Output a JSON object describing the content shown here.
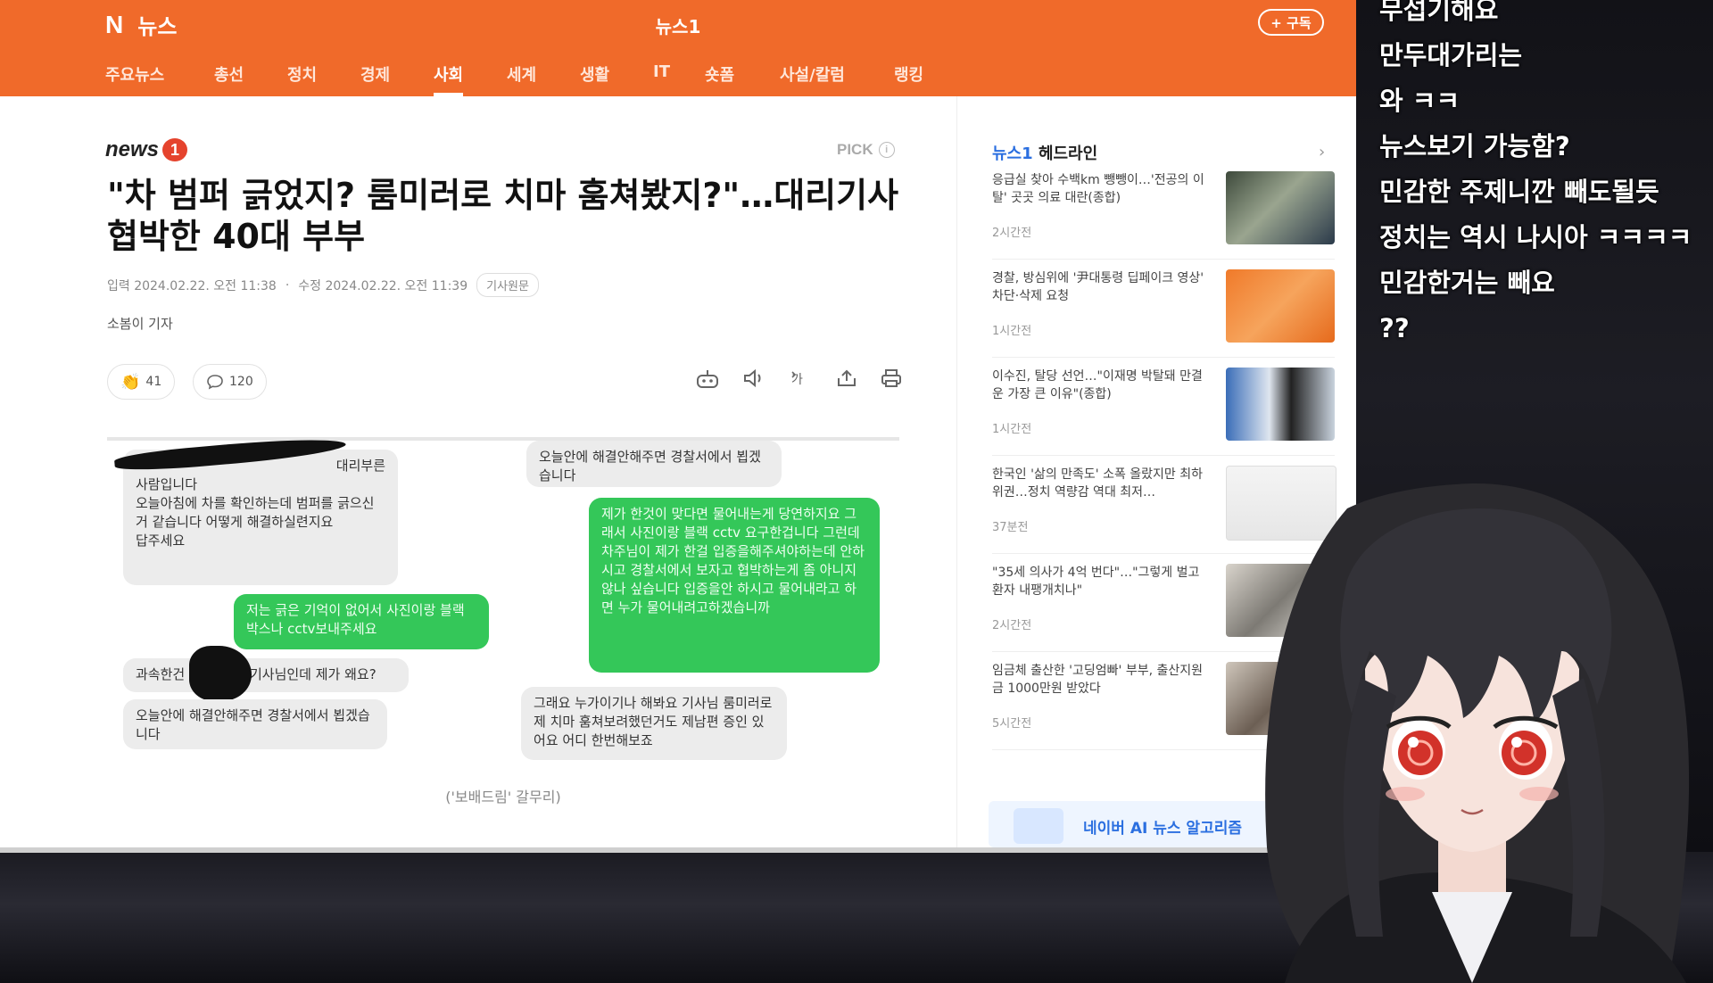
{
  "header": {
    "brand_mark": "N",
    "brand_word": "뉴스",
    "site_title": "뉴스1",
    "subscribe_label": "+ 구독",
    "accent_color": "#f06a2a"
  },
  "nav": {
    "items": [
      "주요뉴스",
      "총선",
      "정치",
      "경제",
      "사회",
      "세계",
      "생활",
      "IT",
      "숏폼",
      "사설/칼럼",
      "랭킹"
    ],
    "active": "사회"
  },
  "article": {
    "logo_text": "news",
    "logo_num": "1",
    "pick_label": "PICK",
    "pick_info": "i",
    "headline_line1": "\"차 범퍼 긁었지? 룸미러로 치마 훔쳐봤지?\"…대리기사",
    "headline_line2": "협박한 40대 부부",
    "meta_input": "입력 2024.02.22. 오전 11:38",
    "meta_sep": "·",
    "meta_edit": "수정 2024.02.22. 오전 11:39",
    "meta_original": "기사원문",
    "reporter": "소봄이 기자",
    "reaction_count": "41",
    "comment_count": "120",
    "caption": "('보배드림' 갈무리)"
  },
  "chat": {
    "left_1_a": "대리부른",
    "left_1_b": "사람입니다",
    "left_1_c": "오늘아침에 차를 확인하는데 범퍼를 긁으신거 같습니다 어떻게 해결하실련지요",
    "left_1_d": "답주세요",
    "right_green_1": "저는 긁은 기억이 없어서 사진이랑 블랙박스나 cctv보내주세요",
    "left_2_a": "과속한건",
    "left_2_b": "기사님인데 제가 왜요?",
    "left_3": "오늘안에 해결안해주면 경찰서에서 뵙겠습니다",
    "top_right": "오늘안에 해결안해주면 경찰서에서 뵙겠습니다",
    "green_long": "제가 한것이 맞다면 물어내는게 당연하지요 그래서 사진이랑 블랙 cctv 요구한겁니다 그런데 차주님이 제가 한걸 입증을해주셔야하는데 안하시고 경찰서에서 보자고 협박하는게 좀 아니지않나 싶습니다 입증을안 하시고 물어내라고 하면 누가 물어내려고하겠습니까",
    "bottom_right": "그래요 누가이기나 해봐요 기사님 룸미러로 제 치마 훔쳐보려했던거도 제남편 증인 있어요 어디 한번해보죠"
  },
  "sidebar": {
    "title_brand": "뉴스1",
    "title_rest": "헤드라인",
    "items": [
      {
        "text": "응급실 찾아 수백km 뺑뺑이…'전공의 이탈' 곳곳 의료 대란(종합)",
        "time": "2시간전"
      },
      {
        "text": "경찰, 방심위에 '尹대통령 딥페이크 영상' 차단·삭제 요청",
        "time": "1시간전"
      },
      {
        "text": "이수진, 탈당 선언…\"이재명 박탈돼 만결운 가장 큰 이유\"(종합)",
        "time": "1시간전"
      },
      {
        "text": "한국인 '삶의 만족도' 소폭 올랐지만 최하위권…정치 역량감 역대 최저…",
        "time": "37분전"
      },
      {
        "text": "\"35세 의사가 4억 번다\"…\"그렇게 벌고 환자 내팽개치나\"",
        "time": "2시간전"
      },
      {
        "text": "임금체 출산한 '고딩엄빠' 부부, 출산지원금 1000만원 받았다",
        "time": "5시간전"
      }
    ],
    "ai_banner": "네이버 AI 뉴스 알고리즘"
  },
  "overlay": {
    "lines": [
      "무섭기해요",
      "만두대가리는",
      "와 ㅋㅋ",
      "뉴스보기 가능함?",
      "민감한 주제니깐 빼도될듯",
      "정치는 역시 나시아 ㅋㅋㅋㅋ",
      "민감한거는 빼요",
      "??"
    ]
  }
}
